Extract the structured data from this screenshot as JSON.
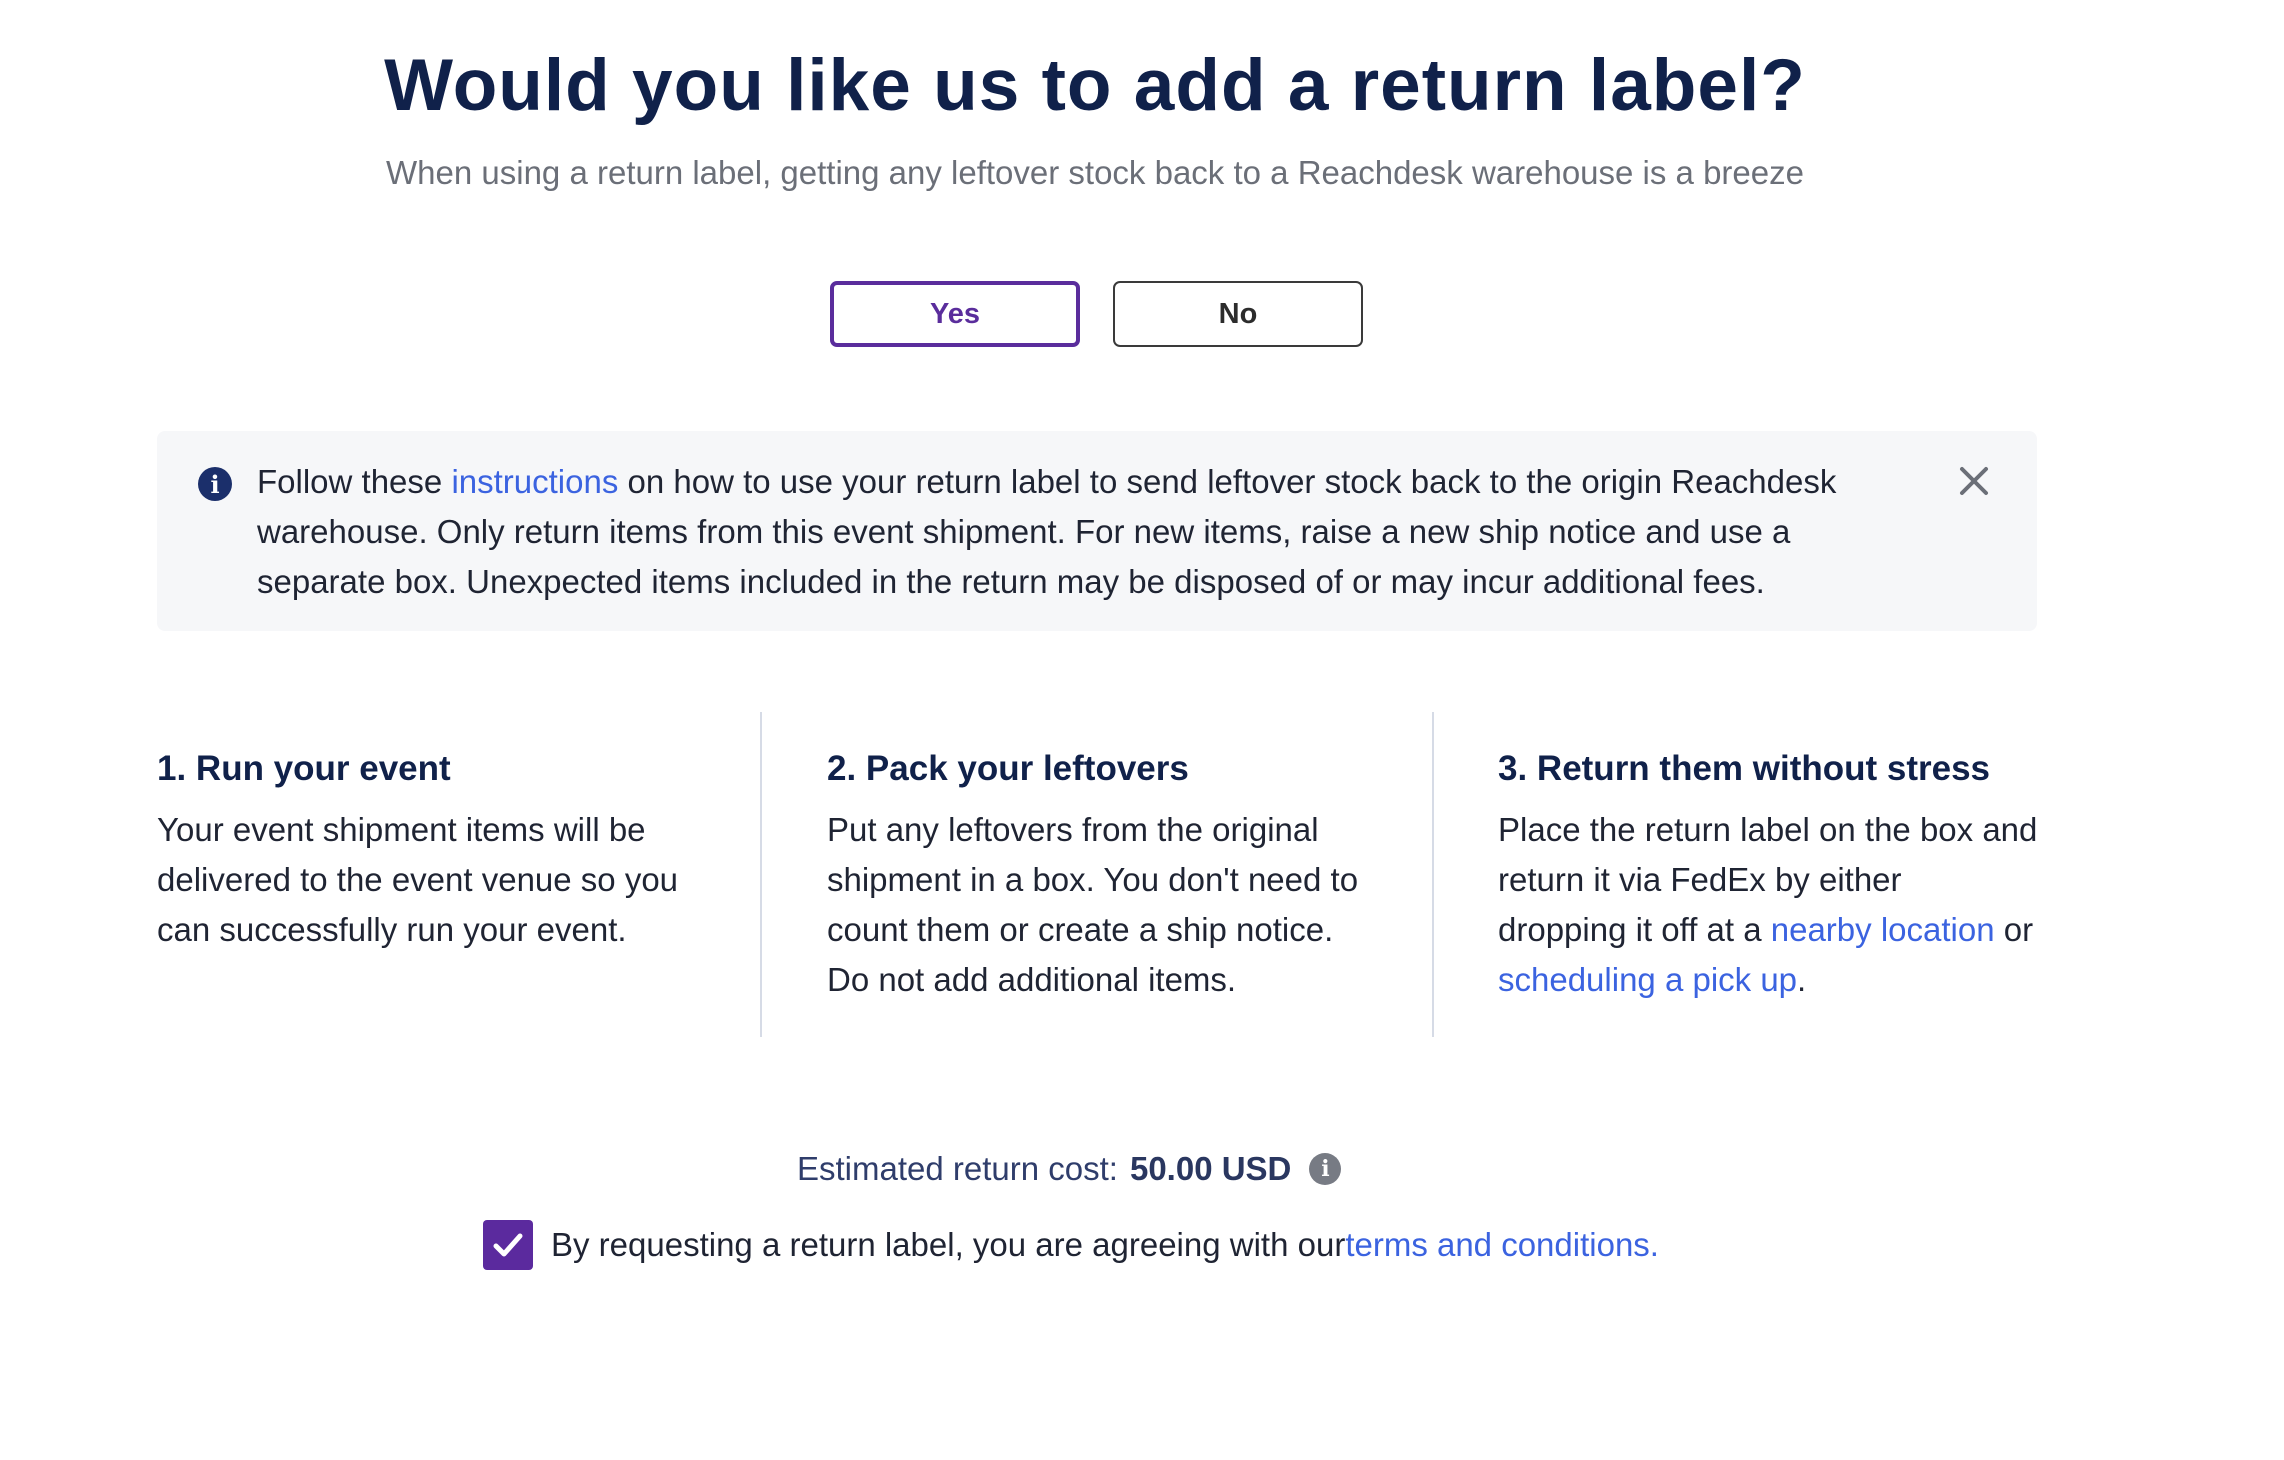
{
  "header": {
    "title": "Would you like us to add a return label?",
    "subtitle": "When using a return label, getting any leftover stock back to a Reachdesk warehouse is a breeze"
  },
  "choices": {
    "yes_label": "Yes",
    "no_label": "No",
    "selected": "Yes"
  },
  "notice": {
    "icon": "info-circle-icon",
    "text_before": "Follow these ",
    "link_text": "instructions",
    "text_after": " on how to use your return label to send leftover stock back to the origin Reachdesk warehouse. Only return items from this event shipment. For new items, raise a new ship notice and use a separate box. Unexpected items included in the return may be disposed of or may incur additional fees.",
    "close_icon": "close-icon"
  },
  "steps": [
    {
      "title": "1. Run your event",
      "body": "Your event shipment items will be delivered to the event venue so you can successfully run your event."
    },
    {
      "title": "2. Pack your leftovers",
      "body": "Put any leftovers from the original shipment in a box. You don't need to count them or create a ship notice. Do not add additional items."
    },
    {
      "title": "3. Return them without stress",
      "body_before": "Place the return label on the box and return it via FedEx by either dropping it off at a ",
      "link1": "nearby location",
      "body_middle": " or ",
      "link2": "scheduling a pick up",
      "body_after": "."
    }
  ],
  "cost": {
    "label": "Estimated return cost:",
    "value": "50.00 USD",
    "icon": "info-circle-icon"
  },
  "agreement": {
    "checked": true,
    "text": "By requesting a return label, you are agreeing with our ",
    "link_text": "terms and conditions."
  },
  "colors": {
    "accent": "#5a2d9c",
    "link": "#3b63e0",
    "heading": "#10214a"
  }
}
